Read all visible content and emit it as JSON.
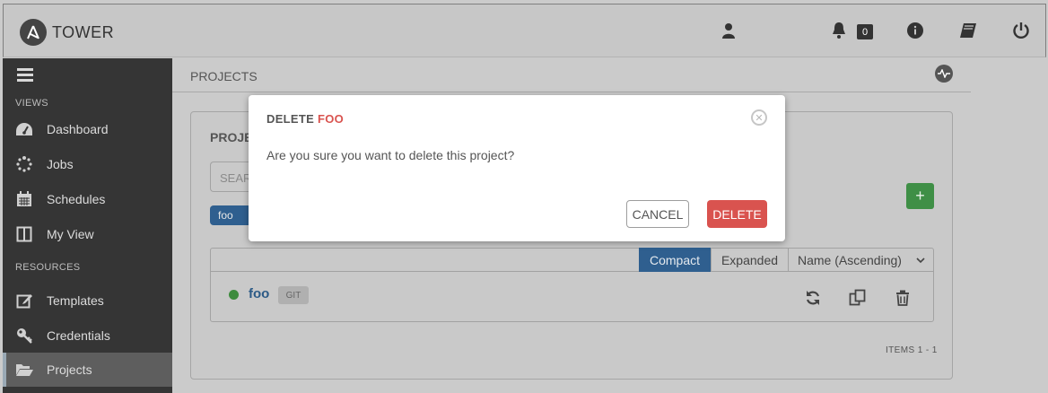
{
  "header": {
    "brand": "TOWER",
    "notification_count": "0"
  },
  "sidebar": {
    "sections": [
      {
        "label": "VIEWS"
      },
      {
        "label": "RESOURCES"
      }
    ],
    "items": [
      {
        "label": "Dashboard",
        "icon": "dashboard-icon"
      },
      {
        "label": "Jobs",
        "icon": "jobs-spinner-icon"
      },
      {
        "label": "Schedules",
        "icon": "calendar-icon"
      },
      {
        "label": "My View",
        "icon": "columns-icon"
      },
      {
        "label": "Templates",
        "icon": "pencil-square-icon"
      },
      {
        "label": "Credentials",
        "icon": "key-icon"
      },
      {
        "label": "Projects",
        "icon": "folder-open-icon",
        "active": true
      }
    ]
  },
  "main": {
    "breadcrumb": "PROJECTS",
    "panel_title": "PROJE",
    "search_placeholder": "SEAR",
    "active_tag": "foo",
    "view_toggle": {
      "compact": "Compact",
      "expanded": "Expanded",
      "selected": "Compact"
    },
    "sort_label": "Name (Ascending)",
    "rows": [
      {
        "name": "foo",
        "scm_type": "GIT",
        "status": "successful",
        "status_color": "#3d8b3d"
      }
    ],
    "items_count": "ITEMS  1 - 1"
  },
  "modal": {
    "title_prefix": "DELETE",
    "title_name": "FOO",
    "body": "Are you sure you want to delete this project?",
    "cancel_label": "CANCEL",
    "delete_label": "DELETE"
  },
  "colors": {
    "accent_blue": "#2f5f8f",
    "delete_red": "#d9534f",
    "add_green": "#3f8f46",
    "sidebar_bg": "#353535"
  }
}
